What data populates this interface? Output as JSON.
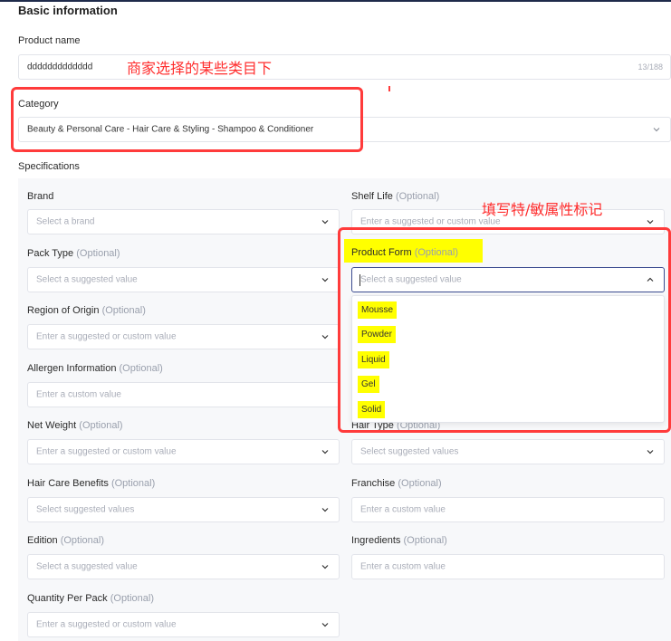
{
  "basic": {
    "section_title": "Basic information",
    "product_name_label": "Product name",
    "product_name_value": "ddddddddddddd",
    "product_name_counter": "13/188",
    "category_label": "Category",
    "category_value": "Beauty & Personal Care - Hair Care & Styling - Shampoo & Conditioner"
  },
  "annotations": {
    "category_note": "商家选择的某些类目下",
    "specs_note": "填写特/敏属性标记",
    "color": "#ff3b3b",
    "highlight_color": "#ffff00"
  },
  "specs": {
    "title": "Specifications",
    "optional": "(Optional)",
    "brand": {
      "label": "Brand",
      "placeholder": "Select a brand"
    },
    "shelf_life": {
      "label": "Shelf Life",
      "placeholder": "Enter a suggested or custom value"
    },
    "pack_type": {
      "label": "Pack Type",
      "placeholder": "Select a suggested value"
    },
    "product_form": {
      "label": "Product Form",
      "placeholder": "Select a suggested value",
      "options": [
        "Mousse",
        "Powder",
        "Liquid",
        "Gel",
        "Solid"
      ]
    },
    "region": {
      "label": "Region of Origin",
      "placeholder": "Enter a suggested or custom value"
    },
    "allergen": {
      "label": "Allergen Information",
      "placeholder": "Enter a custom value"
    },
    "net_weight": {
      "label": "Net Weight",
      "placeholder": "Enter a suggested or custom value"
    },
    "hair_type": {
      "label": "Hair Type",
      "placeholder": "Select suggested values"
    },
    "benefits": {
      "label": "Hair Care Benefits",
      "placeholder": "Select suggested values"
    },
    "franchise": {
      "label": "Franchise",
      "placeholder": "Enter a custom value"
    },
    "edition": {
      "label": "Edition",
      "placeholder": "Select a suggested value"
    },
    "ingredients": {
      "label": "Ingredients",
      "placeholder": "Enter a custom value"
    },
    "quantity": {
      "label": "Quantity Per Pack",
      "placeholder": "Enter a suggested or custom value"
    }
  }
}
